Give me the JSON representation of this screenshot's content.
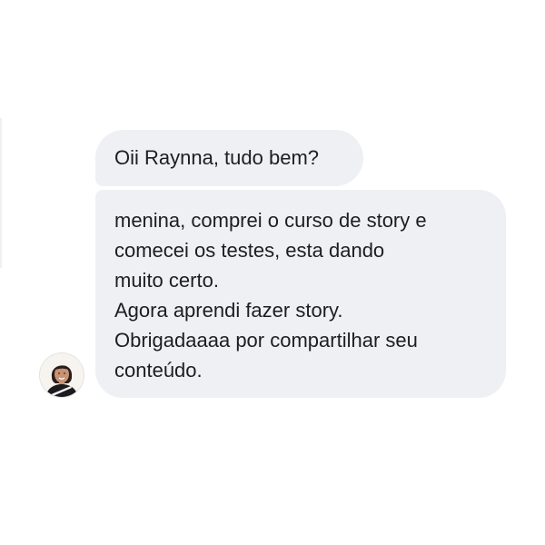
{
  "conversation": {
    "messages": [
      {
        "text": "Oii Raynna, tudo bem?"
      },
      {
        "text": "menina,  comprei o curso de story e\ncomecei os testes, esta dando\nmuito certo.\nAgora aprendi fazer story.\nObrigadaaaa por compartilhar seu\nconteúdo."
      }
    ]
  },
  "sender": {
    "avatar": "profile-photo"
  },
  "colors": {
    "bubble_background": "#eef0f4",
    "text": "#1c1e21",
    "page_background": "#ffffff"
  }
}
